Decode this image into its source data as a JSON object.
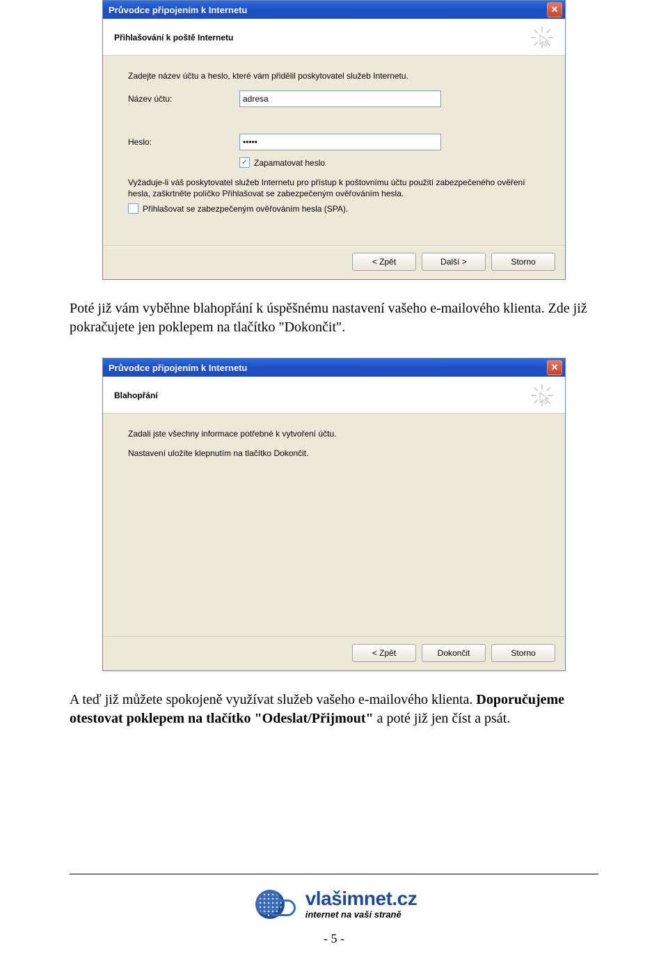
{
  "dialog1": {
    "title": "Průvodce připojením k Internetu",
    "subtitle": "Přihlašování k poště Internetu",
    "instruction": "Zadejte název účtu a heslo, které vám přidělil poskytovatel služeb Internetu.",
    "account_label": "Název účtu:",
    "account_value": "adresa",
    "password_label": "Heslo:",
    "password_value": "•••••",
    "remember_checked": true,
    "remember_label": "Zapamatovat heslo",
    "spa_text": "Vyžaduje-li váš poskytovatel služeb Internetu pro přístup k poštovnímu účtu použití zabezpečeného ověření hesla, zaškrtněte políčko Přihlašovat se zabezpečeným ověřováním hesla.",
    "spa_checked": false,
    "spa_checkbox_label": "Přihlašovat se zabezpečeným ověřováním hesla (SPA).",
    "btn_back": "< Zpět",
    "btn_next": "Další >",
    "btn_cancel": "Storno"
  },
  "para1": "Poté již vám vyběhne blahopřání k úspěšnému nastavení vašeho e-mailového klienta. Zde již pokračujete jen poklepem na tlačítko \"Dokončit\".",
  "dialog2": {
    "title": "Průvodce připojením k Internetu",
    "subtitle": "Blahopřání",
    "line1": "Zadali jste všechny informace potřebné k vytvoření účtu.",
    "line2": "Nastavení uložíte klepnutím na tlačítko Dokončit.",
    "btn_back": "< Zpět",
    "btn_finish": "Dokončit",
    "btn_cancel": "Storno"
  },
  "para2_a": "A teď již můžete spokojeně využívat služeb vašeho e-mailového klienta. ",
  "para2_b": "Doporučujeme otestovat poklepem na tlačítko \"Odeslat/Přijmout\"",
  "para2_c": " a poté již jen číst a psát.",
  "footer": {
    "brand": "vlašimnet",
    "tld": ".cz",
    "tagline": "internet na vaší straně",
    "page_num": "- 5 -"
  }
}
